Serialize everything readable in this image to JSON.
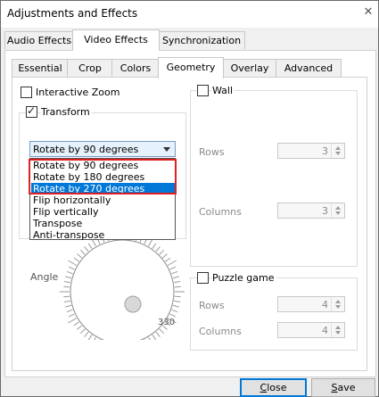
{
  "window": {
    "title": "Adjustments and Effects",
    "close_glyph": "✕"
  },
  "main_tabs": [
    {
      "label": "Audio Effects",
      "active": false
    },
    {
      "label": "Video Effects",
      "active": true
    },
    {
      "label": "Synchronization",
      "active": false
    }
  ],
  "sub_tabs": [
    {
      "label": "Essential",
      "active": false
    },
    {
      "label": "Crop",
      "active": false
    },
    {
      "label": "Colors",
      "active": false
    },
    {
      "label": "Geometry",
      "active": true
    },
    {
      "label": "Overlay",
      "active": false
    },
    {
      "label": "Advanced",
      "active": false
    }
  ],
  "geometry": {
    "interactive_zoom": {
      "label": "Interactive Zoom",
      "checked": false
    },
    "transform": {
      "label": "Transform",
      "checked": true,
      "selected": "Rotate by 90 degrees",
      "options": [
        "Rotate by 90 degrees",
        "Rotate by 180 degrees",
        "Rotate by 270 degrees",
        "Flip horizontally",
        "Flip vertically",
        "Transpose",
        "Anti-transpose"
      ],
      "highlighted_option": "Rotate by 270 degrees"
    },
    "rotate": {
      "angle_label": "Angle",
      "dial_value_label": "330"
    },
    "wall": {
      "label": "Wall",
      "checked": false,
      "rows_label": "Rows",
      "rows_value": "3",
      "columns_label": "Columns",
      "columns_value": "3"
    },
    "puzzle": {
      "label": "Puzzle game",
      "checked": false,
      "rows_label": "Rows",
      "rows_value": "4",
      "columns_label": "Columns",
      "columns_value": "4"
    }
  },
  "footer": {
    "close_label_underlined": "C",
    "close_label_rest": "lose",
    "save_label_underlined": "S",
    "save_label_rest": "ave"
  },
  "colors": {
    "selection": "#0078d7",
    "highlight_box": "#e02020",
    "window_bg": "#f0f0f0"
  }
}
